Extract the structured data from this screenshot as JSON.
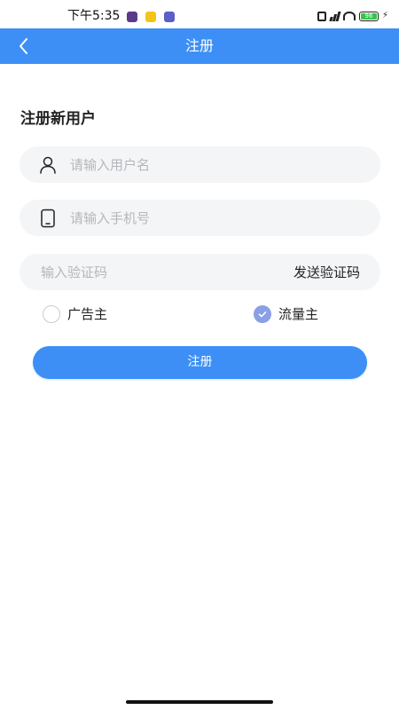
{
  "status_bar": {
    "time": "下午5:35",
    "battery": "96"
  },
  "app_bar": {
    "title": "注册",
    "back_icon": "chevron-left-icon"
  },
  "form": {
    "heading": "注册新用户",
    "username": {
      "placeholder": "请输入用户名",
      "value": "",
      "icon": "user-icon"
    },
    "phone": {
      "placeholder": "请输入手机号",
      "value": "",
      "icon": "phone-icon"
    },
    "code": {
      "placeholder": "输入验证码",
      "value": "",
      "send_label": "发送验证码"
    },
    "roles": [
      {
        "label": "广告主",
        "selected": false
      },
      {
        "label": "流量主",
        "selected": true
      }
    ],
    "submit_label": "注册"
  },
  "colors": {
    "primary": "#3d8ff5",
    "field_bg": "#f4f5f6",
    "radio_checked": "#8b9fe6"
  }
}
